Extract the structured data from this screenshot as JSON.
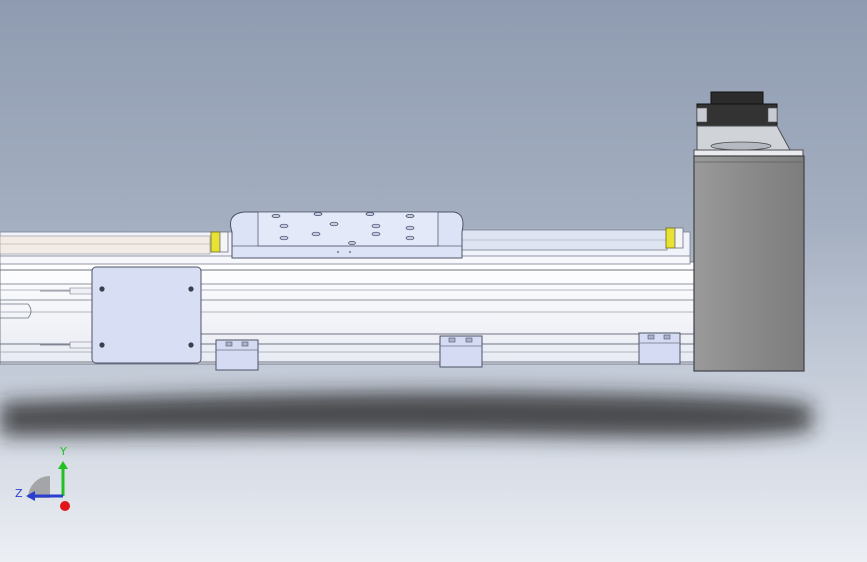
{
  "viewport": {
    "background_top": "#8f9bb0",
    "background_bottom": "#eceff4"
  },
  "model": {
    "type": "linear-actuator",
    "parts": [
      "rail-body",
      "sliding-carriage",
      "end-cover-plate",
      "mounting-blocks",
      "motor-housing",
      "stepper-motor",
      "end-stops"
    ],
    "mounting_block_count": 3,
    "colors": {
      "rail": "#f4f6fb",
      "carriage": "#dde3f6",
      "plate": "#d8def4",
      "motor_housing": "#8a8a8a",
      "motor": "#2b2b2b",
      "end_stop": "#e8e232",
      "shadow": "#2a2a2a"
    }
  },
  "triad": {
    "y_label": "Y",
    "z_label": "Z",
    "y_color": "#22c022",
    "z_color": "#2a3fd0",
    "x_color": "#e01818"
  }
}
